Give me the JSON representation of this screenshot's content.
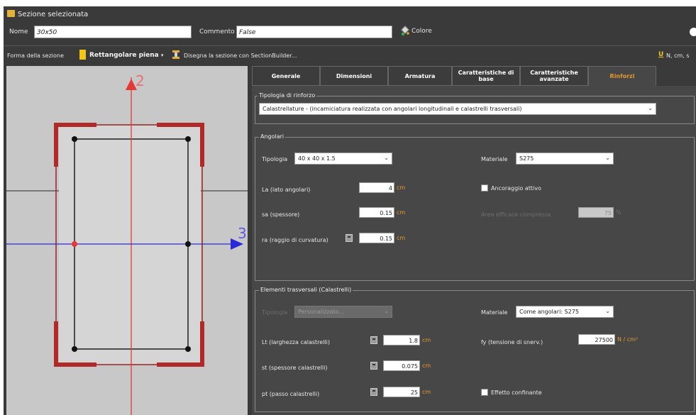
{
  "header": {
    "title": "Sezione selezionata",
    "name_label": "Nome",
    "name_value": "30x50",
    "comment_label": "Commento",
    "comment_value": "False",
    "color_label": "Colore"
  },
  "toolbar": {
    "shape_label": "Forma della sezione",
    "shape_value": "Rettangolare piena",
    "sectionbuilder_label": "Disegna la sezione con SectionBuilder...",
    "units_icon": "U",
    "units_label": "N, cm, s"
  },
  "drawing": {
    "axis_2": "2",
    "axis_3": "3",
    "colors": {
      "background": "#c8c8c8",
      "axis_red": "#e53935",
      "axis_blue": "#2929d9",
      "reinforcement": "#b12a2a"
    }
  },
  "tabs": [
    {
      "label": "Generale",
      "active": false
    },
    {
      "label": "Dimensioni",
      "active": false
    },
    {
      "label": "Armatura",
      "active": false
    },
    {
      "label": "Caratteristiche di base",
      "active": false
    },
    {
      "label": "Caratteristiche avanzate",
      "active": false
    },
    {
      "label": "Rinforzi",
      "active": true
    }
  ],
  "reinforcement": {
    "group_title": "Tipologia di rinforzo",
    "type_value": "Calastrellature - (incamiciatura realizzata con angolari longitudinali e calastrelli trasversali)"
  },
  "angles": {
    "group_title": "Angolari",
    "tipologia_label": "Tipologia",
    "tipologia_value": "40 x 40 x 1.5",
    "materiale_label": "Materiale",
    "materiale_value": "S275",
    "la_label": "La (lato angolari)",
    "la_value": "4",
    "la_unit": "cm",
    "sa_label": "sa (spessore)",
    "sa_value": "0.15",
    "sa_unit": "cm",
    "ra_label": "ra (raggio di curvatura)",
    "ra_value": "0.15",
    "ra_unit": "cm",
    "anchor_label": "Ancoraggio attivo",
    "eff_label": "Area efficace compressa",
    "eff_value": "75",
    "eff_unit": "%"
  },
  "transversal": {
    "group_title": "Elementi trasversali (Calastrelli)",
    "tipologia_label": "Tipologia",
    "tipologia_value": "Personalizzato...",
    "materiale_label": "Materiale",
    "materiale_value": "Come angolari: S275",
    "lt_label": "Lt (larghezza calastrelli)",
    "lt_value": "1.8",
    "lt_unit": "cm",
    "st_label": "st (spessore calastrelli)",
    "st_value": "0.075",
    "st_unit": "cm",
    "pt_label": "pt (passo calastrelli)",
    "pt_value": "25",
    "pt_unit": "cm",
    "fy_label": "fy (tensione di snerv.)",
    "fy_value": "27500",
    "fy_unit": "N / cm²",
    "confining_label": "Effetto confinante"
  }
}
